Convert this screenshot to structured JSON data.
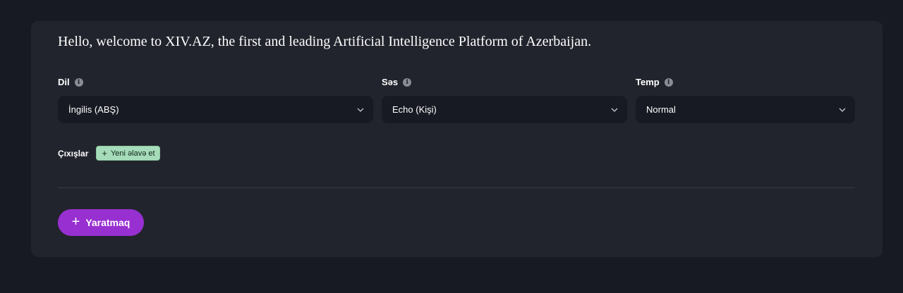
{
  "headline": "Hello, welcome to XIV.AZ, the first and leading Artificial Intelligence Platform of Azerbaijan.",
  "fields": {
    "language": {
      "label": "Dil",
      "value": "İngilis (ABŞ)"
    },
    "voice": {
      "label": "Səs",
      "value": "Echo (Kişi)"
    },
    "temp": {
      "label": "Temp",
      "value": "Normal"
    }
  },
  "outputs": {
    "label": "Çıxışlar",
    "add_label": "Yeni əlavə et"
  },
  "create_button": {
    "label": "Yaratmaq"
  },
  "icons": {
    "info": "info-icon",
    "chevron": "chevron-down-icon",
    "plus": "plus-icon"
  },
  "colors": {
    "page_bg": "#181a23",
    "card_bg": "#22242d",
    "accent": "#9830d1",
    "add_button": "#a6dcb9"
  }
}
